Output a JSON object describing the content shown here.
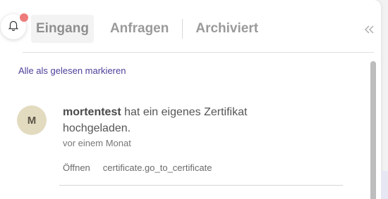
{
  "tabs": [
    {
      "label": "Eingang",
      "active": true
    },
    {
      "label": "Anfragen",
      "active": false
    },
    {
      "label": "Archiviert",
      "active": false
    }
  ],
  "icons": {
    "bell": "bell-icon",
    "collapse": "double-chevron-left-icon"
  },
  "mark_all_label": "Alle als gelesen markieren",
  "notification": {
    "avatar_initial": "M",
    "user": "mortentest",
    "message": " hat ein eigenes Zertifikat hochgeladen.",
    "time": "vor einem Monat",
    "actions": {
      "open": "Öffnen",
      "certificate": "certificate.go_to_certificate"
    }
  },
  "colors": {
    "link": "#4b3f9a",
    "badge": "#ee7b7b",
    "avatar_bg": "#e3dbc0"
  }
}
